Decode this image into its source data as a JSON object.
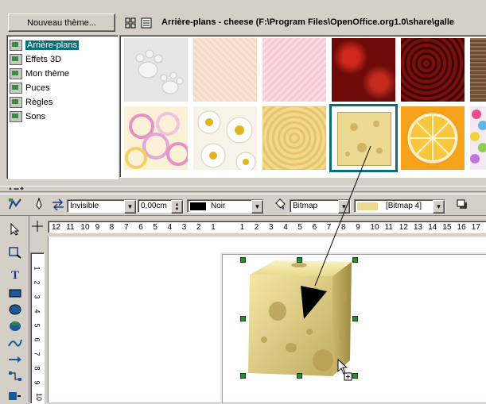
{
  "gallery": {
    "new_theme_button": "Nouveau thème...",
    "title": "Arrière-plans - cheese  (F:\\Program Files\\OpenOffice.org1.0\\share\\galle",
    "themes": [
      {
        "label": "Arrière-plans",
        "selected": true
      },
      {
        "label": "Effets 3D",
        "selected": false
      },
      {
        "label": "Mon thème",
        "selected": false
      },
      {
        "label": "Puces",
        "selected": false
      },
      {
        "label": "Règles",
        "selected": false
      },
      {
        "label": "Sons",
        "selected": false
      }
    ],
    "thumbnails": [
      "paws",
      "beige-texture",
      "pink-texture",
      "red-roses",
      "dark-red-texture",
      "brown-texture",
      "pink-rings",
      "daisies",
      "yellow-flowers",
      "cheese",
      "orange-slice",
      "candy"
    ]
  },
  "toolbar": {
    "line_style": "Invisible",
    "line_width": "0,00cm",
    "line_color": "Noir",
    "fill_type": "Bitmap",
    "fill_value": "[Bitmap 4]"
  },
  "ruler": {
    "h_labels": [
      "12",
      "11",
      "10",
      "9",
      "8",
      "7",
      "6",
      "5",
      "4",
      "3",
      "2",
      "1",
      "",
      "1",
      "2",
      "3",
      "4",
      "5",
      "6",
      "7",
      "8",
      "9",
      "10",
      "11",
      "12",
      "13",
      "14",
      "15",
      "16",
      "17"
    ],
    "v_labels": [
      "1",
      "2",
      "3",
      "4",
      "5",
      "6",
      "7",
      "8",
      "9",
      "10"
    ]
  },
  "icons": [
    "grid-view-icon",
    "list-view-icon",
    "select-arrow-icon",
    "text-icon",
    "rectangle-icon",
    "ellipse-icon",
    "3d-object-icon",
    "curve-icon",
    "line-icon",
    "connector-icon"
  ],
  "colors": {
    "selection": "#0a6e77",
    "handles": "#2e8b2e",
    "cheese": "#e8d98a"
  }
}
